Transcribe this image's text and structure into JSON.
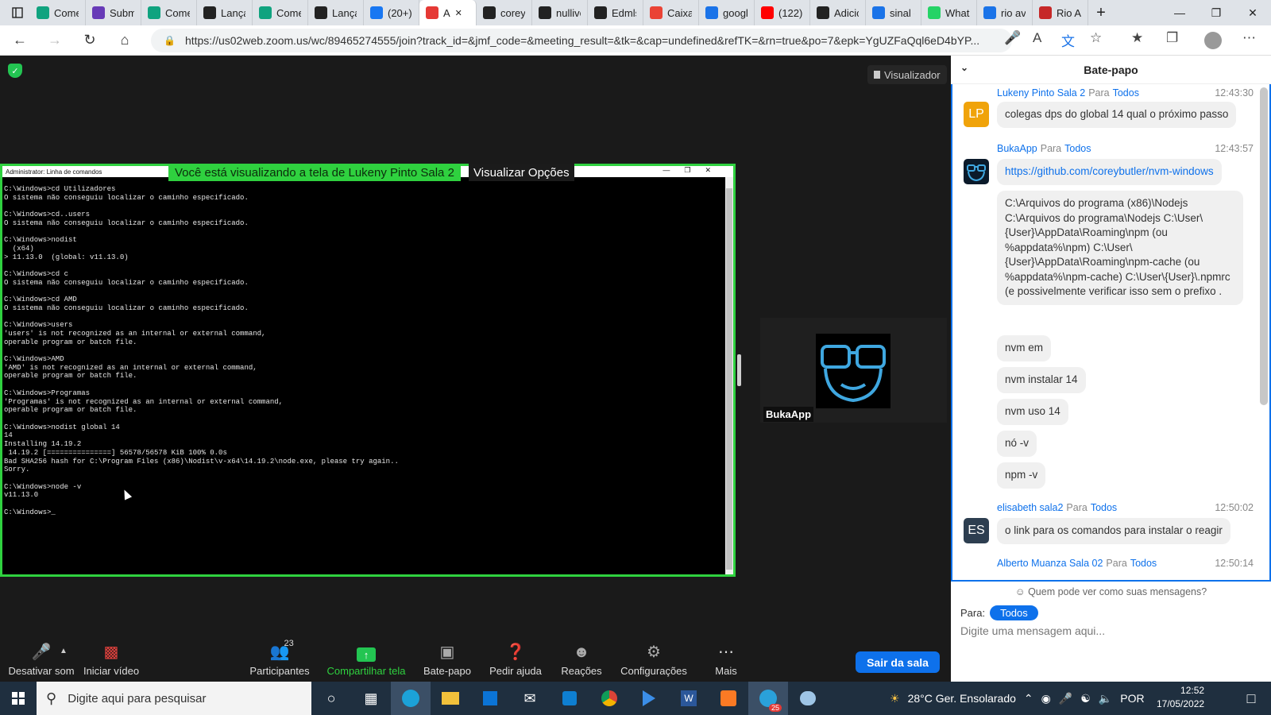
{
  "browser": {
    "tabs": [
      {
        "label": "Come",
        "icon": "chatgpt-icon",
        "color": "#10a37f"
      },
      {
        "label": "Subm",
        "icon": "form-icon",
        "color": "#673ab7"
      },
      {
        "label": "Come",
        "icon": "chatgpt-icon",
        "color": "#10a37f"
      },
      {
        "label": "Lança",
        "icon": "github-icon",
        "color": "#222222"
      },
      {
        "label": "Come",
        "icon": "chatgpt-icon",
        "color": "#10a37f"
      },
      {
        "label": "Lança",
        "icon": "github-icon",
        "color": "#222222"
      },
      {
        "label": "(20+)",
        "icon": "facebook-icon",
        "color": "#1877f2"
      },
      {
        "label": "A",
        "icon": "record-icon",
        "color": "#e53935"
      },
      {
        "label": "coreyt",
        "icon": "github-icon",
        "color": "#222222"
      },
      {
        "label": "nullive",
        "icon": "github-icon",
        "color": "#222222"
      },
      {
        "label": "Edmls",
        "icon": "github-icon",
        "color": "#222222"
      },
      {
        "label": "Caixa",
        "icon": "gmail-icon",
        "color": "#ea4335"
      },
      {
        "label": "googl",
        "icon": "search-icon",
        "color": "#1a73e8"
      },
      {
        "label": "(122)",
        "icon": "youtube-icon",
        "color": "#ff0000"
      },
      {
        "label": "Adicic",
        "icon": "github-icon",
        "color": "#222222"
      },
      {
        "label": "sinal c",
        "icon": "search-icon",
        "color": "#1a73e8"
      },
      {
        "label": "Whats",
        "icon": "whatsapp-icon",
        "color": "#25d366"
      },
      {
        "label": "rio ave",
        "icon": "search-icon",
        "color": "#1a73e8"
      },
      {
        "label": "Rio Av",
        "icon": "news-icon",
        "color": "#c62828"
      }
    ],
    "url": "https://us02web.zoom.us/wc/89465274555/join?track_id=&jmf_code=&meeting_result=&tk=&cap=undefined&refTK=&rn=true&po=7&epk=YgUZFaQql6eD4bYP..."
  },
  "zoom": {
    "viewer_label": "Visualizador",
    "share_banner": "Você está visualizando a tela de Lukeny Pinto Sala 2",
    "share_options": "Visualizar Opções",
    "cmd_title": "Administrator: Linha de comandos",
    "cmd_output": "C:\\Windows>cd Utilizadores\nO sistema não conseguiu localizar o caminho especificado.\n\nC:\\Windows>cd..users\nO sistema não conseguiu localizar o caminho especificado.\n\nC:\\Windows>nodist\n  (x64)\n> 11.13.0  (global: v11.13.0)\n\nC:\\Windows>cd c\nO sistema não conseguiu localizar o caminho especificado.\n\nC:\\Windows>cd AMD\nO sistema não conseguiu localizar o caminho especificado.\n\nC:\\Windows>users\n'users' is not recognized as an internal or external command,\noperable program or batch file.\n\nC:\\Windows>AMD\n'AMD' is not recognized as an internal or external command,\noperable program or batch file.\n\nC:\\Windows>Programas\n'Programas' is not recognized as an internal or external command,\noperable program or batch file.\n\nC:\\Windows>nodist global 14\n14\nInstalling 14.19.2\n 14.19.2 [===============] 56578/56578 KiB 100% 0.0s\nBad SHA256 hash for C:\\Program Files (x86)\\Nodist\\v-x64\\14.19.2\\node.exe, please try again..\nSorry.\n\nC:\\Windows>node -v\nv11.13.0\n\nC:\\Windows>_",
    "participant_name": "BukaApp",
    "toolbar": {
      "mute": "Desativar som",
      "video": "Iniciar vídeo",
      "participants": "Participantes",
      "participants_count": "23",
      "share": "Compartilhar tela",
      "chat": "Bate-papo",
      "help": "Pedir ajuda",
      "reactions": "Reações",
      "settings": "Configurações",
      "more": "Mais",
      "leave": "Sair da sala"
    }
  },
  "chat": {
    "title": "Bate-papo",
    "messages": [
      {
        "sender": "Lukeny Pinto Sala 2",
        "para": "Para",
        "to": "Todos",
        "time": "12:43:30",
        "avatar": "LP",
        "avatar_color": "#f0a30a",
        "bubbles": [
          "colegas dps do global 14 qual o próximo passo"
        ]
      },
      {
        "sender": "BukaApp",
        "para": "Para",
        "to": "Todos",
        "time": "12:43:57",
        "avatar": "",
        "avatar_color": "#0b1a2a",
        "bubbles": [
          "https://github.com/coreybutler/nvm-windows",
          "C:\\Arquivos do programa (x86)\\Nodejs C:\\Arquivos do programa\\Nodejs C:\\User\\{User}\\AppData\\Roaming\\npm (ou %appdata%\\npm) C:\\User\\{User}\\AppData\\Roaming\\npm-cache (ou %appdata%\\npm-cache) C:\\User\\{User}\\.npmrc (e possivelmente verificar isso sem o prefixo .",
          "nvm em",
          "nvm instalar 14",
          "nvm uso 14",
          "nó -v",
          "npm -v"
        ]
      },
      {
        "sender": "elisabeth sala2",
        "para": "Para",
        "to": "Todos",
        "time": "12:50:02",
        "avatar": "ES",
        "avatar_color": "#2d3e50",
        "bubbles": [
          "o link para os comandos para instalar o reagir"
        ]
      },
      {
        "sender": "Alberto Muanza Sala 02",
        "para": "Para",
        "to": "Todos",
        "time": "12:50:14",
        "avatar": "",
        "avatar_color": "#777777",
        "bubbles": []
      }
    ],
    "privacy": "Quem pode ver como suas mensagens?",
    "to_label": "Para:",
    "to_value": "Todos",
    "placeholder": "Digite uma mensagem aqui..."
  },
  "taskbar": {
    "search_placeholder": "Digite aqui para pesquisar",
    "weather": "28°C  Ger. Ensolarado",
    "language": "POR",
    "time": "12:52",
    "date": "17/05/2022",
    "telegram_badge": "25"
  },
  "colors": {
    "zoom_blue": "#0e71eb",
    "share_green": "#2fd13f",
    "taskbar": "#1f2f3f"
  }
}
